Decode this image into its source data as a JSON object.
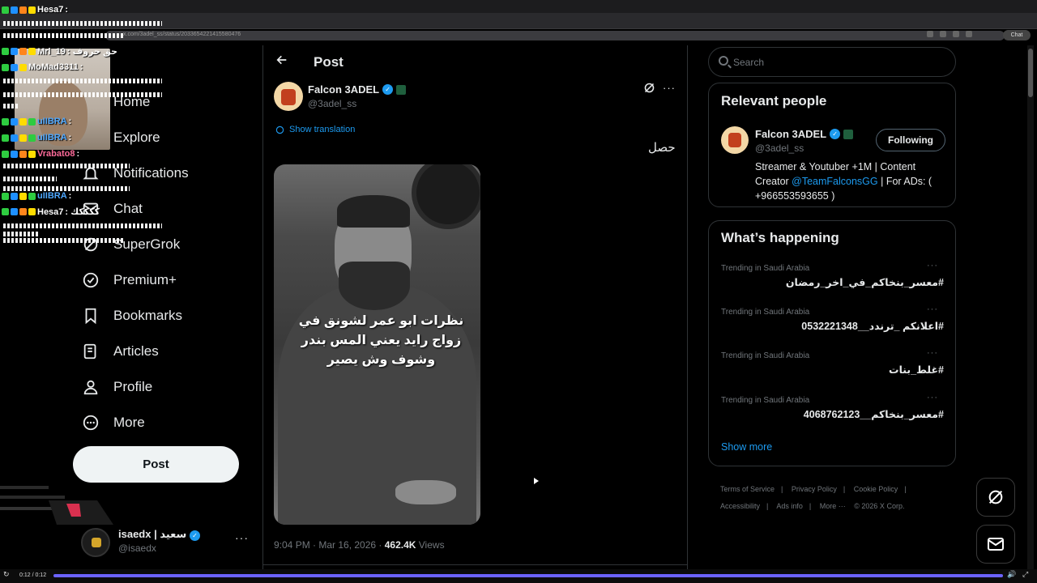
{
  "browser": {
    "url": "x.com/3adel_ss/status/2033654221415580476",
    "profile_label": "Chat"
  },
  "chat": {
    "lines": [
      {
        "user": "Hesa7",
        "text": ":"
      },
      {
        "user": "Mrl_19",
        "text": ": حق حروف"
      },
      {
        "user": "MoMad3311",
        "text": ":"
      },
      {
        "user": "uIIBRA",
        "text": ":"
      },
      {
        "user": "uIIBRA",
        "text": ":"
      },
      {
        "user": "Vrabato8",
        "text": ":"
      },
      {
        "user": "uIIBRA",
        "text": ":"
      },
      {
        "user": "Hesa7",
        "text": ": ككككك"
      }
    ]
  },
  "nav": {
    "items": [
      {
        "label": "Home",
        "icon": "home-icon"
      },
      {
        "label": "Explore",
        "icon": "search-icon"
      },
      {
        "label": "Notifications",
        "icon": "bell-icon"
      },
      {
        "label": "Chat",
        "icon": "mail-icon"
      },
      {
        "label": "SuperGrok",
        "icon": "grok-icon"
      },
      {
        "label": "Premium+",
        "icon": "premium-icon"
      },
      {
        "label": "Bookmarks",
        "icon": "bookmark-icon"
      },
      {
        "label": "Articles",
        "icon": "article-icon"
      },
      {
        "label": "Profile",
        "icon": "profile-icon"
      },
      {
        "label": "More",
        "icon": "more-circle-icon"
      }
    ],
    "post_button": "Post"
  },
  "account": {
    "name": "isaedx | سعيد",
    "handle": "@isaedx",
    "more": "···"
  },
  "post": {
    "header_title": "Post",
    "author_name": "Falcon 3ADEL",
    "author_handle": "@3adel_ss",
    "show_translation": "Show translation",
    "text": "حصل",
    "media_caption": "نظرات ابو عمر لشونق في زواج رايد يعني المس بندر وشوف وش يصير",
    "time": "9:04 PM · Mar 16, 2026 · ",
    "views_count": "462.4K",
    "views_label": " Views",
    "more": "···"
  },
  "search": {
    "placeholder": "Search"
  },
  "relevant": {
    "title": "Relevant people",
    "name": "Falcon 3ADEL",
    "handle": "@3adel_ss",
    "follow_label": "Following",
    "bio_start": "Streamer & Youtuber +1M | Content Creator ",
    "bio_mention": "@TeamFalconsGG",
    "bio_end": " | For ADs: ( +966553593655 )"
  },
  "happening": {
    "title": "What’s happening",
    "trends": [
      {
        "context": "Trending in Saudi Arabia",
        "name": "#معسر_بنخاكم_في_اخر_رمضان"
      },
      {
        "context": "Trending in Saudi Arabia",
        "name": "#اعلانكم _ترندد__0532221348"
      },
      {
        "context": "Trending in Saudi Arabia",
        "name": "#غلط_بنات"
      },
      {
        "context": "Trending in Saudi Arabia",
        "name": "#معسر_بنخاكم__4068762123"
      }
    ],
    "show_more": "Show more",
    "more": "···"
  },
  "footer": {
    "links": [
      "Terms of Service",
      "|",
      "Privacy Policy",
      "|",
      "Cookie Policy",
      "|",
      "Accessibility",
      "|",
      "Ads info",
      "|",
      "More ···",
      "© 2026 X Corp."
    ]
  },
  "video": {
    "time": "0:12 / 0:12"
  },
  "colors": {
    "accent": "#1d9bf0",
    "background": "#000000",
    "progress": "#6c63ff"
  }
}
